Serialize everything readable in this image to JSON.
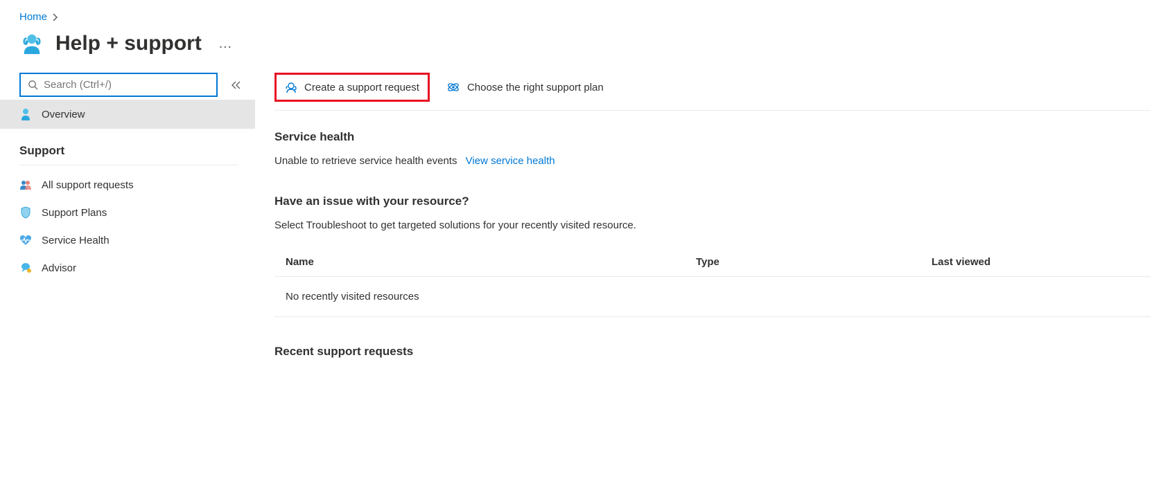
{
  "breadcrumb": {
    "home": "Home"
  },
  "page": {
    "title": "Help + support",
    "more_label": "…"
  },
  "search": {
    "placeholder": "Search (Ctrl+/)"
  },
  "sidebar": {
    "overview": "Overview",
    "section_label": "Support",
    "items": [
      {
        "label": "All support requests"
      },
      {
        "label": "Support Plans"
      },
      {
        "label": "Service Health"
      },
      {
        "label": "Advisor"
      }
    ]
  },
  "toolbar": {
    "create_request": "Create a support request",
    "choose_plan": "Choose the right support plan"
  },
  "service_health": {
    "heading": "Service health",
    "status_text": "Unable to retrieve service health events",
    "link_text": "View service health"
  },
  "resource_issue": {
    "heading": "Have an issue with your resource?",
    "subtext": "Select Troubleshoot to get targeted solutions for your recently visited resource.",
    "columns": {
      "name": "Name",
      "type": "Type",
      "last": "Last viewed"
    },
    "empty": "No recently visited resources"
  },
  "recent_requests": {
    "heading": "Recent support requests"
  }
}
